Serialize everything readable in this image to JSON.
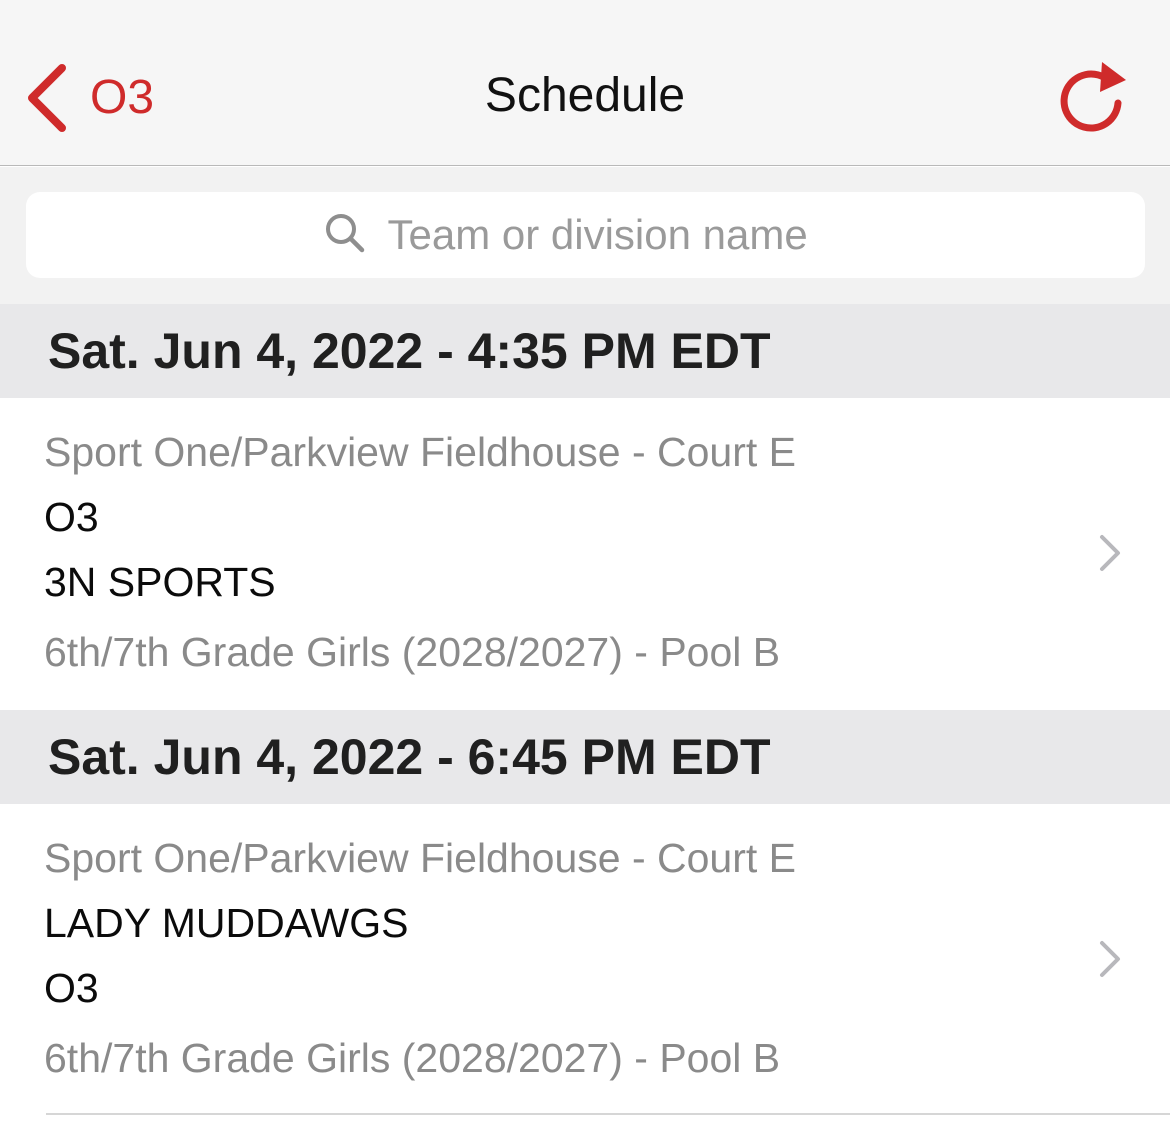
{
  "nav": {
    "back_label": "O3",
    "title": "Schedule",
    "accent_color": "#cf2b2b"
  },
  "search": {
    "placeholder": "Team or division name",
    "value": ""
  },
  "games": [
    {
      "datetime": "Sat. Jun 4, 2022 - 4:35 PM EDT",
      "location": "Sport One/Parkview Fieldhouse - Court E",
      "team1": "O3",
      "team2": "3N SPORTS",
      "division": "6th/7th Grade Girls (2028/2027) - Pool B"
    },
    {
      "datetime": "Sat. Jun 4, 2022 - 6:45 PM EDT",
      "location": "Sport One/Parkview Fieldhouse - Court E",
      "team1": "LADY MUDDAWGS",
      "team2": "O3",
      "division": "6th/7th Grade Girls (2028/2027) - Pool B"
    }
  ],
  "icons": {
    "back": "chevron-left-icon",
    "refresh": "refresh-icon",
    "search": "search-icon",
    "row_disclosure": "chevron-right-icon"
  }
}
